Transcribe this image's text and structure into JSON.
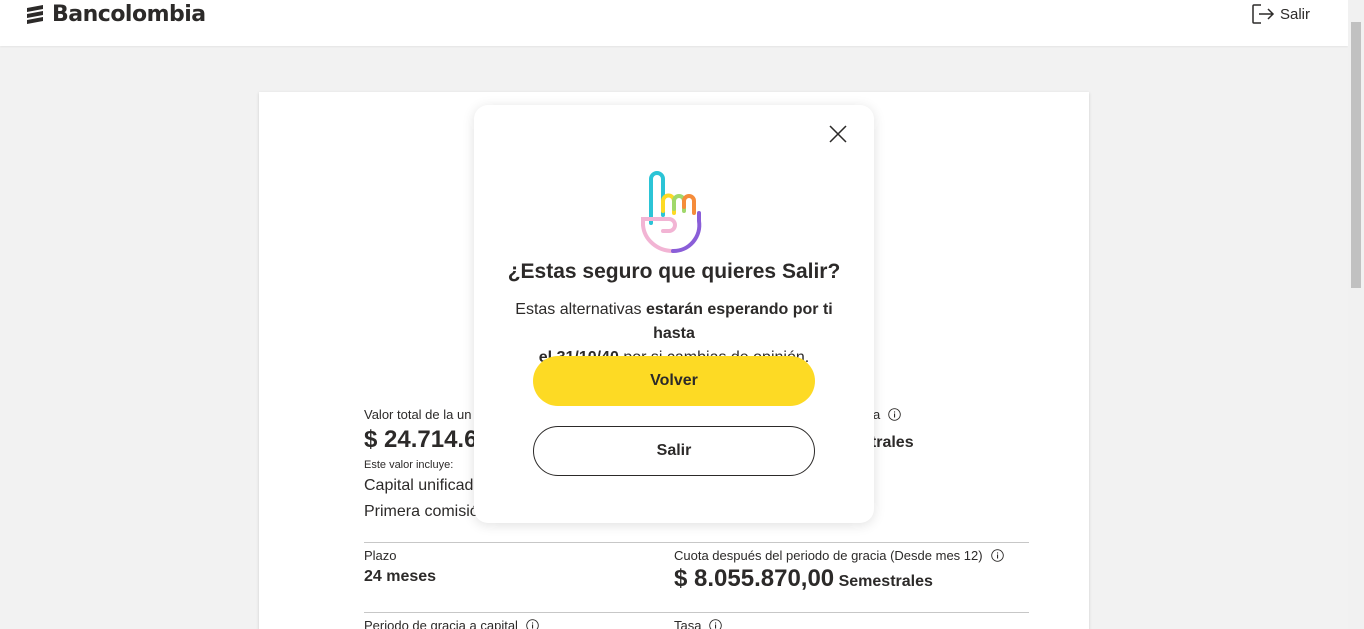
{
  "header": {
    "brand": "Bancolombia",
    "logout_label": "Salir",
    "logo_icon": "bancolombia-logo-icon",
    "logout_icon": "exit-door-icon"
  },
  "card": {
    "total_label": "Valor total de la un",
    "total_value": "$ 24.714.6",
    "includes_label": "Este valor incluye:",
    "includes_items": [
      "Capital unificad",
      "Primera comisió"
    ],
    "right_label_fragment": "a",
    "right_value_fragment": "strales",
    "term_label": "Plazo",
    "term_value": "24 meses",
    "quota_label": "Cuota después del periodo de gracia (Desde mes 12)",
    "quota_value": "$ 8.055.870,00",
    "quota_unit": "Semestrales",
    "grace_label": "Periodo de gracia a capital",
    "rate_label": "Tasa"
  },
  "modal": {
    "title": "¿Estas seguro que quieres Salir?",
    "body_prefix": "Estas alternativas",
    "body_bold_1": "estarán esperando por ti hasta",
    "body_bold_2": "el 31/10/40",
    "body_suffix": "por si cambias de opinión.",
    "primary_label": "Volver",
    "secondary_label": "Salir",
    "illustration_icon": "hand-pointing-up-icon",
    "close_icon": "close-icon"
  },
  "colors": {
    "primary_yellow": "#fdda24",
    "text_dark": "#2c2a29",
    "page_bg": "#f2f2f2"
  }
}
